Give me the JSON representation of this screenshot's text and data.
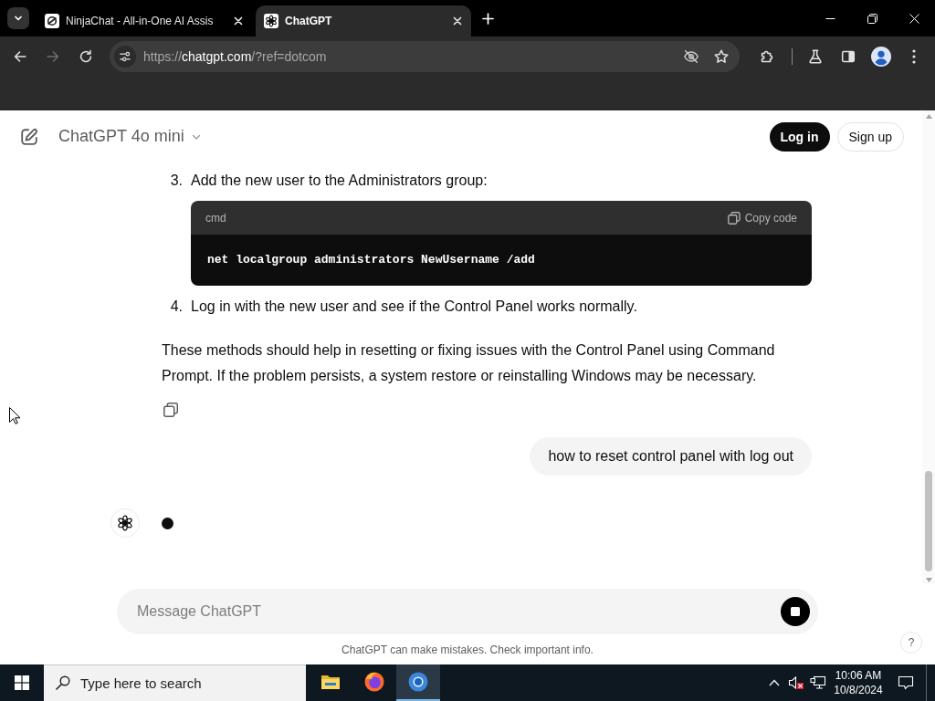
{
  "browser": {
    "tabs": [
      {
        "title": "NinjaChat - All-in-One AI Assis",
        "kind": "swirl",
        "selected": false
      },
      {
        "title": "ChatGPT",
        "kind": "knot",
        "selected": true
      }
    ],
    "forward_disabled": true,
    "address": {
      "scheme": "https://",
      "host": "chatgpt.com",
      "path": "/?ref=dotcom"
    }
  },
  "header": {
    "model": "ChatGPT 4o mini",
    "buttons": [
      {
        "label": "Log in",
        "kind": "primary"
      },
      {
        "label": "Sign up",
        "kind": "outline"
      }
    ]
  },
  "thread": {
    "steps": [
      {
        "number": "3.",
        "text": "Add the new user to the Administrators group:",
        "code": {
          "language": "cmd",
          "copy_label": "Copy code",
          "text": "net localgroup administrators NewUsername /add"
        }
      },
      {
        "number": "4.",
        "text": "Log in with the new user and see if the Control Panel works normally."
      }
    ],
    "paragraph": "These methods should help in resetting or fixing issues with the Control Panel using Command Prompt. If the problem persists, a system restore or reinstalling Windows may be necessary.",
    "user_message": "how to reset control panel with log out",
    "assistant_typing": true
  },
  "composer": {
    "placeholder": "Message ChatGPT",
    "generating": true
  },
  "footer": {
    "disclaimer": "ChatGPT can make mistakes. Check important info.",
    "help": "?"
  },
  "taskbar": {
    "search_placeholder": "Type here to search",
    "apps": [
      {
        "kind": "explorer",
        "selected": false
      },
      {
        "kind": "firefox",
        "selected": false
      },
      {
        "kind": "chrome",
        "selected": true
      }
    ],
    "time": "10:06 AM",
    "date": "10/8/2024"
  }
}
